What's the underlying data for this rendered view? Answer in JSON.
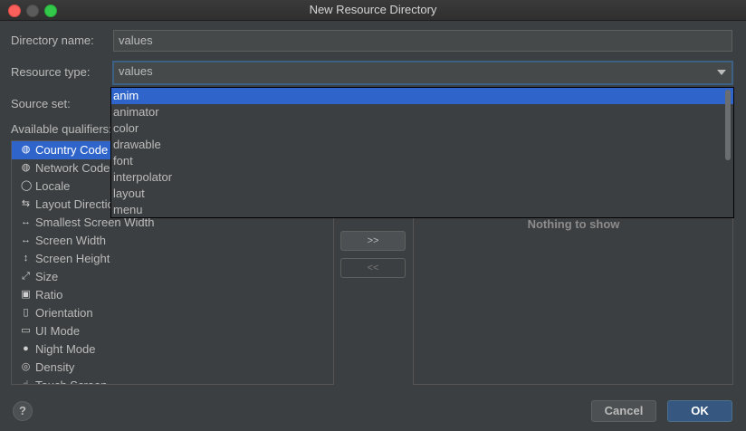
{
  "window": {
    "title": "New Resource Directory"
  },
  "form": {
    "directory_name_label": "Directory name:",
    "directory_name_value": "values",
    "resource_type_label": "Resource type:",
    "resource_type_value": "values",
    "source_set_label": "Source set:",
    "available_qualifiers_label": "Available qualifiers:"
  },
  "qualifiers": [
    {
      "label": "Country Code",
      "icon": "globe-pin-icon",
      "glyph": "◍"
    },
    {
      "label": "Network Code",
      "icon": "network-icon",
      "glyph": "◍"
    },
    {
      "label": "Locale",
      "icon": "globe-icon",
      "glyph": "◯"
    },
    {
      "label": "Layout Direction",
      "icon": "direction-icon",
      "glyph": "⇆"
    },
    {
      "label": "Smallest Screen Width",
      "icon": "width-icon",
      "glyph": "↔"
    },
    {
      "label": "Screen Width",
      "icon": "width-icon",
      "glyph": "↔"
    },
    {
      "label": "Screen Height",
      "icon": "height-icon",
      "glyph": "↕"
    },
    {
      "label": "Size",
      "icon": "size-icon",
      "glyph": "⤢"
    },
    {
      "label": "Ratio",
      "icon": "ratio-icon",
      "glyph": "▣"
    },
    {
      "label": "Orientation",
      "icon": "orientation-icon",
      "glyph": "▯"
    },
    {
      "label": "UI Mode",
      "icon": "ui-mode-icon",
      "glyph": "▭"
    },
    {
      "label": "Night Mode",
      "icon": "night-mode-icon",
      "glyph": "●"
    },
    {
      "label": "Density",
      "icon": "density-icon",
      "glyph": "◎"
    },
    {
      "label": "Touch Screen",
      "icon": "touch-icon",
      "glyph": "☝"
    }
  ],
  "move_buttons": {
    "add": ">>",
    "remove": "<<"
  },
  "chosen_qualifiers": {
    "empty_text": "Nothing to show"
  },
  "dropdown_options": [
    "anim",
    "animator",
    "color",
    "drawable",
    "font",
    "interpolator",
    "layout",
    "menu"
  ],
  "dropdown_selected": "anim",
  "buttons": {
    "help": "?",
    "cancel": "Cancel",
    "ok": "OK"
  },
  "colors": {
    "accent": "#2f65ca",
    "background": "#3c3f41",
    "ok_button": "#365880"
  }
}
